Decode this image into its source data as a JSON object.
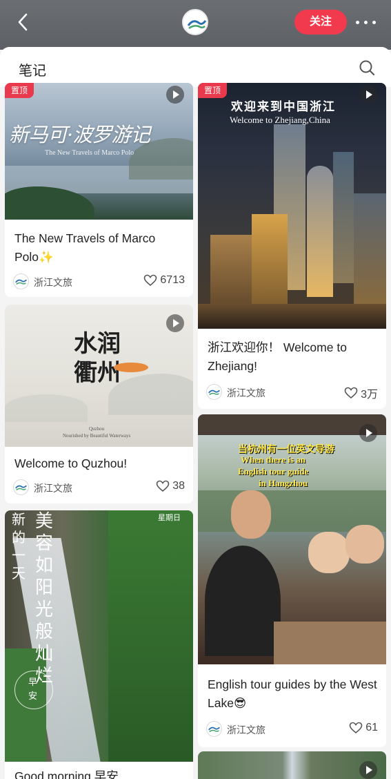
{
  "header": {
    "follow_label": "关注"
  },
  "section": {
    "title": "笔记"
  },
  "notes": [
    {
      "id": "marco",
      "pinned_label": "置顶",
      "title": "The New Travels of Marco Polo✨",
      "author": "浙江文旅",
      "likes": "6713",
      "image_text_cn": "新马可·波罗游记",
      "image_text_en": "The New Travels of Marco Polo"
    },
    {
      "id": "zhejiang",
      "pinned_label": "置顶",
      "title": "浙江欢迎你！ Welcome to Zhejiang!",
      "author": "浙江文旅",
      "likes": "3万",
      "image_text_cn": "欢迎来到中国浙江",
      "image_text_en": "Welcome to Zhejiang,China"
    },
    {
      "id": "quzhou",
      "title": "Welcome to Quzhou!",
      "author": "浙江文旅",
      "likes": "38",
      "image_text_cn": "水润衢州",
      "image_text_en_1": "Quzhou",
      "image_text_en_2": "Nourished by Beautiful Waterways"
    },
    {
      "id": "westlake",
      "title": "English tour guides by the West Lake😎",
      "author": "浙江文旅",
      "likes": "61",
      "image_text_1": "当杭州有一位英文导游",
      "image_text_2": "When there is an",
      "image_text_3": "English tour guide",
      "image_text_4": "in Hangzhou"
    },
    {
      "id": "morning",
      "title": "Good morning 早安",
      "image_text_cn_1": "美容如阳光般灿烂",
      "image_text_cn_2": "新的一天",
      "image_text_day": "星期日",
      "image_text_stamp": "早安"
    },
    {
      "id": "fifth"
    }
  ],
  "colors": {
    "accent": "#f23a4e",
    "pin": "#e83a4c"
  }
}
